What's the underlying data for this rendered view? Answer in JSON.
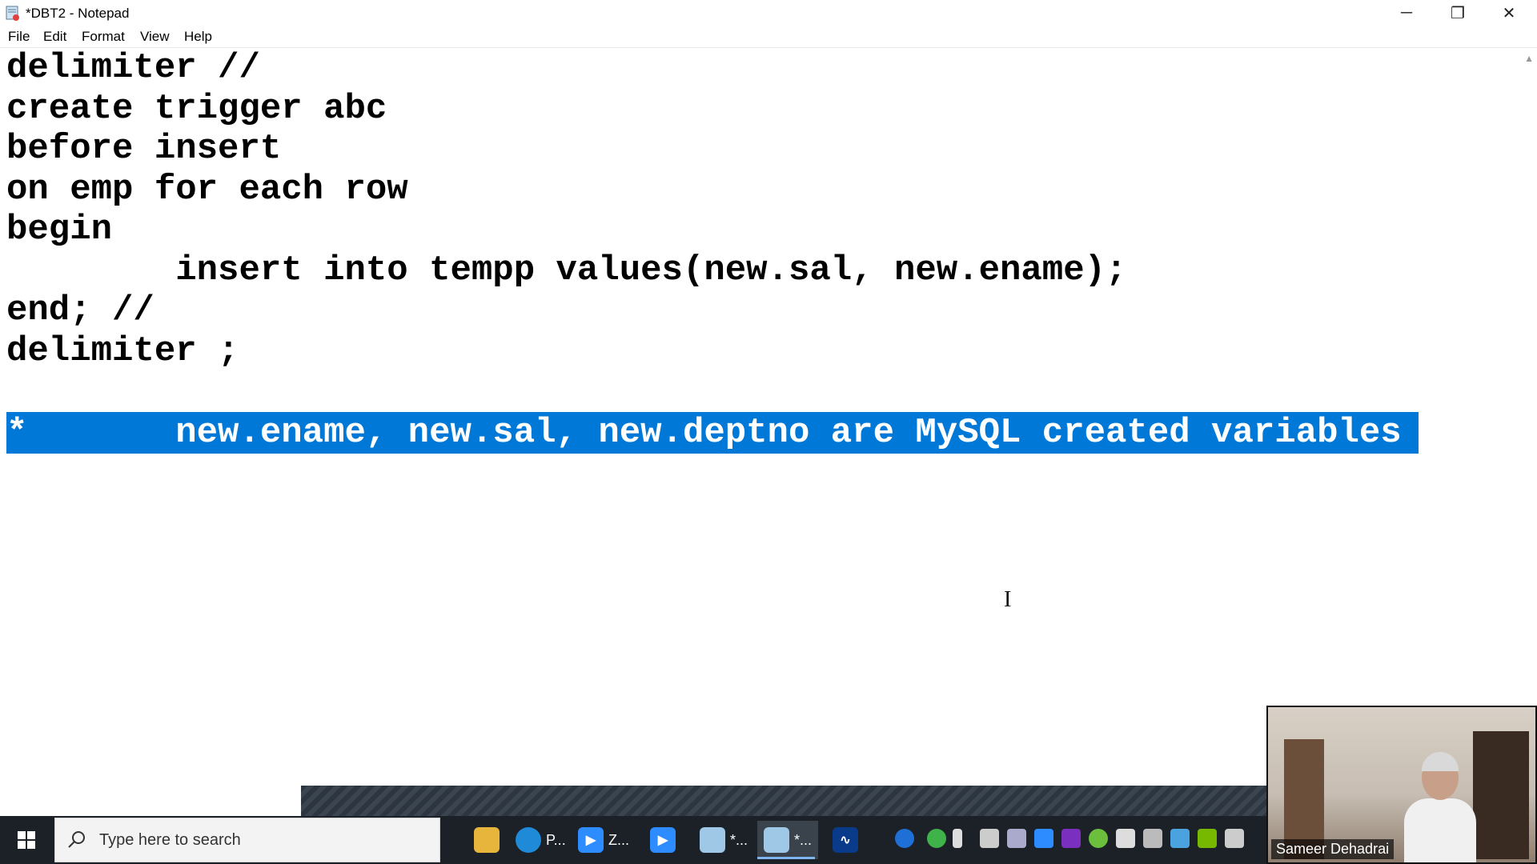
{
  "window": {
    "title": "*DBT2 - Notepad",
    "minimize": "─",
    "restore": "❐",
    "close": "✕"
  },
  "menu": [
    "File",
    "Edit",
    "Format",
    "View",
    "Help"
  ],
  "editor": {
    "lines": [
      "delimiter //",
      "create trigger abc",
      "before insert",
      "on emp for each row",
      "begin",
      "        insert into tempp values(new.sal, new.ename);",
      "end; //",
      "delimiter ;"
    ],
    "selected_line": "*       new.ename, new.sal, new.deptno are MySQL created variables"
  },
  "taskbar": {
    "search_placeholder": "Type here to search",
    "apps": [
      {
        "name": "file-explorer",
        "label": ""
      },
      {
        "name": "edge",
        "label": "P..."
      },
      {
        "name": "zoom",
        "label": "Z..."
      },
      {
        "name": "zoom-meeting",
        "label": ""
      },
      {
        "name": "notepad-1",
        "label": "*..."
      },
      {
        "name": "notepad-2",
        "label": "*..."
      },
      {
        "name": "stocks",
        "label": ""
      }
    ]
  },
  "video": {
    "participant_name": "Sameer Dehadrai"
  },
  "colors": {
    "selection": "#0078d7",
    "taskbar": "#1c2127"
  }
}
